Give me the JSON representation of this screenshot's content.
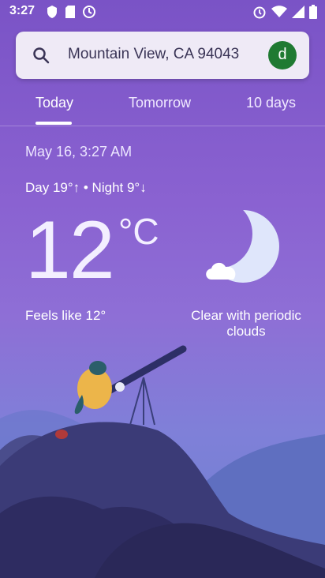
{
  "status_bar": {
    "time": "3:27",
    "left_icons": [
      "shield-icon",
      "sd-card-icon",
      "sync-icon"
    ],
    "right_icons": [
      "alarm-icon",
      "wifi-icon",
      "signal-icon",
      "battery-icon"
    ]
  },
  "search": {
    "location": "Mountain View, CA 94043",
    "avatar_letter": "d"
  },
  "tabs": [
    {
      "label": "Today",
      "active": true
    },
    {
      "label": "Tomorrow",
      "active": false
    },
    {
      "label": "10 days",
      "active": false
    }
  ],
  "weather": {
    "date_time": "May 16, 3:27 AM",
    "day_night": "Day 19°↑ • Night 9°↓",
    "temperature": "12",
    "unit": "°C",
    "feels_like": "Feels like 12°",
    "condition": "Clear with periodic clouds",
    "condition_icon": "moon-cloud-icon"
  },
  "colors": {
    "background_top": "#7a53c6",
    "background_bottom": "#6c7ed0",
    "avatar": "#1f7a32",
    "search_bar": "#efeaf6"
  }
}
